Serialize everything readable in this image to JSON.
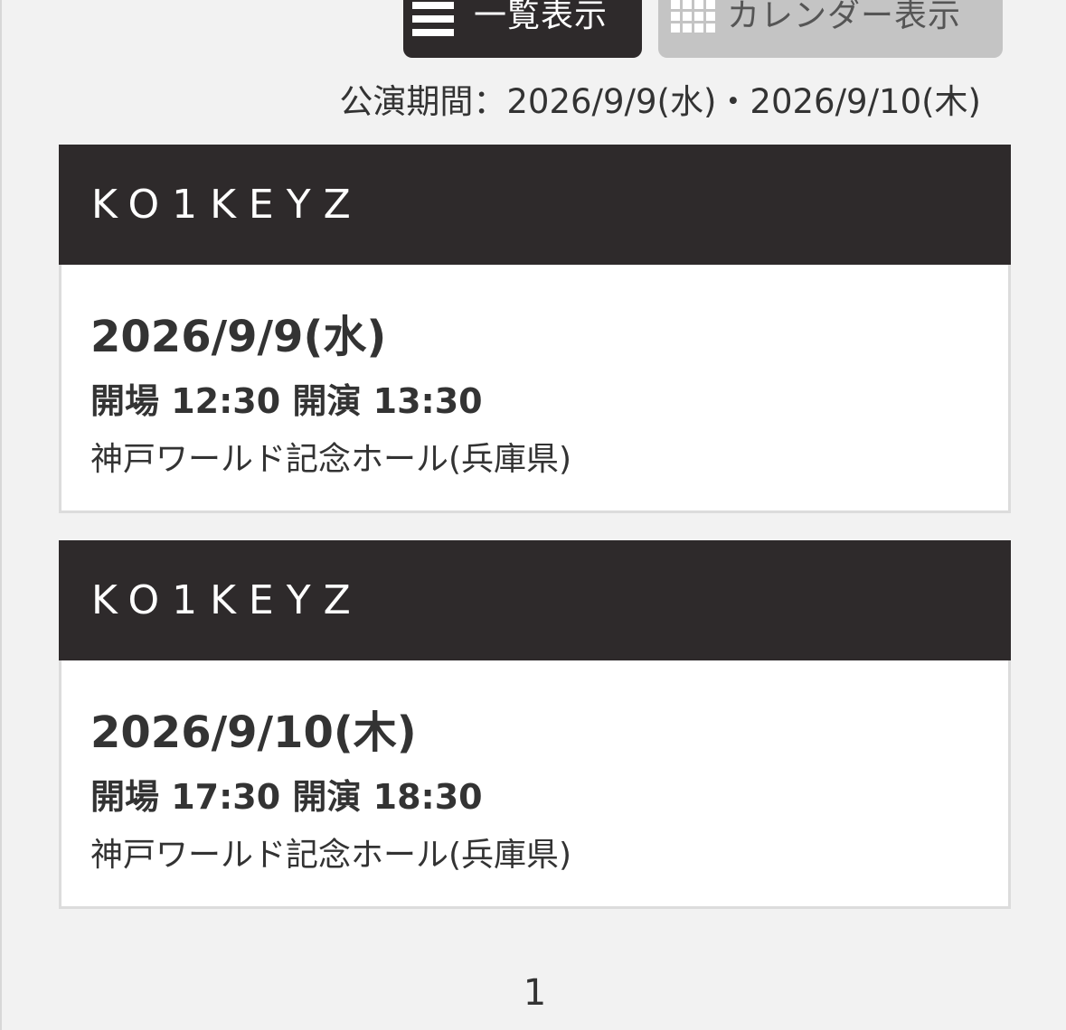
{
  "view_toggle": {
    "list": {
      "label": "一覧表示",
      "icon": "list-icon",
      "active": true
    },
    "calendar": {
      "label": "カレンダー表示",
      "icon": "grid-icon",
      "active": false
    }
  },
  "period_text": "公演期間：2026/9/9(水)・2026/9/10(木)",
  "events": [
    {
      "artist": "KO1KEYZ",
      "date": "2026/9/9(水)",
      "times": "開場 12:30 開演 13:30",
      "venue": "神戸ワールド記念ホール(兵庫県)"
    },
    {
      "artist": "KO1KEYZ",
      "date": "2026/9/10(木)",
      "times": "開場 17:30 開演 18:30",
      "venue": "神戸ワールド記念ホール(兵庫県)"
    }
  ],
  "pagination": {
    "current": "1"
  },
  "colors": {
    "header_bg": "#2e2a2b",
    "page_bg": "#f2f2f2",
    "inactive_button": "#c4c4c4"
  }
}
